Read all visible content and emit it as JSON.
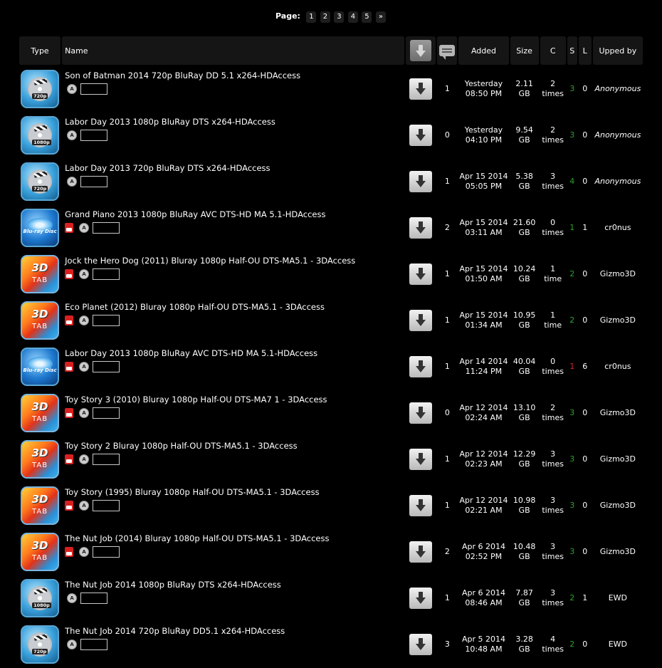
{
  "pager": {
    "label": "Page:",
    "pages": [
      "1",
      "2",
      "3",
      "4",
      "5"
    ],
    "next": "»"
  },
  "headers": {
    "type": "Type",
    "name": "Name",
    "added": "Added",
    "size": "Size",
    "completed": "C",
    "seeders": "S",
    "leechers": "L",
    "upped_by": "Upped by"
  },
  "rows": [
    {
      "icon": "720p-hd-icon",
      "res": "720p",
      "name": "Son of Batman 2014 720p BluRay DD 5.1 x264-HDAccess",
      "trailer": false,
      "comments": "1",
      "date": "Yesterday",
      "time": "08:50 PM",
      "size_num": "2.11",
      "size_unit": "GB",
      "c_num": "2",
      "c_unit": "times",
      "seeders": "3",
      "s_color": "green",
      "leechers": "0",
      "upper": "Anonymous"
    },
    {
      "icon": "1080p-hd-icon",
      "res": "1080p",
      "name": "Labor Day 2013 1080p BluRay DTS x264-HDAccess",
      "trailer": false,
      "comments": "0",
      "date": "Yesterday",
      "time": "04:10 PM",
      "size_num": "9.54",
      "size_unit": "GB",
      "c_num": "2",
      "c_unit": "times",
      "seeders": "3",
      "s_color": "green",
      "leechers": "0",
      "upper": "Anonymous"
    },
    {
      "icon": "720p-hd-icon",
      "res": "720p",
      "name": "Labor Day 2013 720p BluRay DTS x264-HDAccess",
      "trailer": false,
      "comments": "1",
      "date": "Apr 15 2014",
      "time": "05:05 PM",
      "size_num": "5.38",
      "size_unit": "GB",
      "c_num": "3",
      "c_unit": "times",
      "seeders": "4",
      "s_color": "green",
      "leechers": "0",
      "upper": "Anonymous"
    },
    {
      "icon": "bluray-icon",
      "res": "Blu-ray Disc",
      "name": "Grand Piano 2013 1080p BluRay AVC DTS-HD MA 5.1-HDAccess",
      "trailer": true,
      "comments": "2",
      "date": "Apr 15 2014",
      "time": "03:11 AM",
      "size_num": "21.60",
      "size_unit": "GB",
      "c_num": "0",
      "c_unit": "times",
      "seeders": "1",
      "s_color": "green",
      "leechers": "1",
      "upper": "cr0nus"
    },
    {
      "icon": "3d-tab-icon",
      "res": "3D TAB",
      "name": "Jock the Hero Dog (2011) Bluray 1080p Half-OU DTS-MA5.1 - 3DAccess",
      "trailer": true,
      "comments": "1",
      "date": "Apr 15 2014",
      "time": "01:50 AM",
      "size_num": "10.24",
      "size_unit": "GB",
      "c_num": "1",
      "c_unit": "time",
      "seeders": "2",
      "s_color": "green",
      "leechers": "0",
      "upper": "Gizmo3D"
    },
    {
      "icon": "3d-tab-icon",
      "res": "3D TAB",
      "name": "Eco Planet (2012) Bluray 1080p Half-OU DTS-MA5.1 - 3DAccess",
      "trailer": true,
      "comments": "1",
      "date": "Apr 15 2014",
      "time": "01:34 AM",
      "size_num": "10.95",
      "size_unit": "GB",
      "c_num": "1",
      "c_unit": "time",
      "seeders": "2",
      "s_color": "green",
      "leechers": "0",
      "upper": "Gizmo3D"
    },
    {
      "icon": "bluray-icon",
      "res": "Blu-ray Disc",
      "name": "Labor Day 2013 1080p BluRay AVC DTS-HD MA 5.1-HDAccess",
      "trailer": true,
      "comments": "1",
      "date": "Apr 14 2014",
      "time": "11:24 PM",
      "size_num": "40.04",
      "size_unit": "GB",
      "c_num": "0",
      "c_unit": "times",
      "seeders": "1",
      "s_color": "red",
      "leechers": "6",
      "upper": "cr0nus"
    },
    {
      "icon": "3d-tab-icon",
      "res": "3D TAB",
      "name": "Toy Story 3 (2010) Bluray 1080p Half-OU DTS-MA7 1 - 3DAccess",
      "trailer": true,
      "comments": "0",
      "date": "Apr 12 2014",
      "time": "02:24 AM",
      "size_num": "13.10",
      "size_unit": "GB",
      "c_num": "2",
      "c_unit": "times",
      "seeders": "3",
      "s_color": "green",
      "leechers": "0",
      "upper": "Gizmo3D"
    },
    {
      "icon": "3d-tab-icon",
      "res": "3D TAB",
      "name": "Toy Story 2 Bluray 1080p Half-OU DTS-MA5.1 - 3DAccess",
      "trailer": true,
      "comments": "1",
      "date": "Apr 12 2014",
      "time": "02:23 AM",
      "size_num": "12.29",
      "size_unit": "GB",
      "c_num": "3",
      "c_unit": "times",
      "seeders": "3",
      "s_color": "green",
      "leechers": "0",
      "upper": "Gizmo3D"
    },
    {
      "icon": "3d-tab-icon",
      "res": "3D TAB",
      "name": "Toy Story (1995) Bluray 1080p Half-OU DTS-MA5.1 - 3DAccess",
      "trailer": true,
      "comments": "1",
      "date": "Apr 12 2014",
      "time": "02:21 AM",
      "size_num": "10.98",
      "size_unit": "GB",
      "c_num": "3",
      "c_unit": "times",
      "seeders": "3",
      "s_color": "green",
      "leechers": "0",
      "upper": "Gizmo3D"
    },
    {
      "icon": "3d-tab-icon",
      "res": "3D TAB",
      "name": "The Nut Job (2014) Bluray 1080p Half-OU DTS-MA5.1 - 3DAccess",
      "trailer": true,
      "comments": "2",
      "date": "Apr 6 2014",
      "time": "02:52 PM",
      "size_num": "10.48",
      "size_unit": "GB",
      "c_num": "3",
      "c_unit": "times",
      "seeders": "3",
      "s_color": "green",
      "leechers": "0",
      "upper": "Gizmo3D"
    },
    {
      "icon": "1080p-hd-icon",
      "res": "1080p",
      "name": "The Nut Job 2014 1080p BluRay DTS x264-HDAccess",
      "trailer": false,
      "comments": "1",
      "date": "Apr 6 2014",
      "time": "08:46 AM",
      "size_num": "7.87",
      "size_unit": "GB",
      "c_num": "3",
      "c_unit": "times",
      "seeders": "2",
      "s_color": "green",
      "leechers": "1",
      "upper": "EWD"
    },
    {
      "icon": "720p-hd-icon",
      "res": "720p",
      "name": "The Nut Job 2014 720p BluRay DD5.1 x264-HDAccess",
      "trailer": false,
      "comments": "3",
      "date": "Apr 5 2014",
      "time": "10:48 AM",
      "size_num": "3.28",
      "size_unit": "GB",
      "c_num": "4",
      "c_unit": "times",
      "seeders": "2",
      "s_color": "green",
      "leechers": "0",
      "upper": "EWD"
    }
  ],
  "imdb_glyph": "A",
  "colors": {
    "seed_green": "#2aa42a",
    "seed_red": "#dd2222",
    "header_bg": "#151515"
  }
}
